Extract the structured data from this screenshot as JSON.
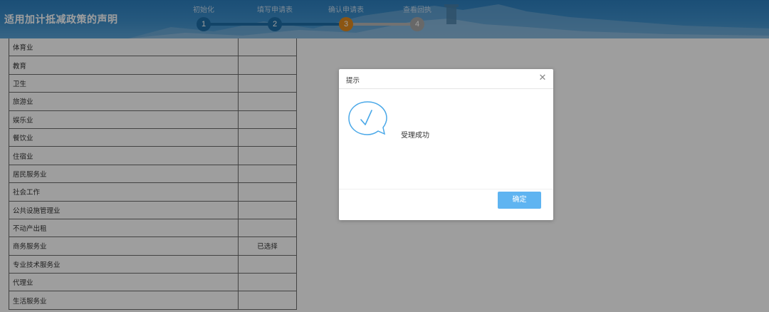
{
  "header": {
    "title": "适用加计抵减政策的声明",
    "steps": [
      {
        "label": "初始化",
        "number": "1",
        "state": "done"
      },
      {
        "label": "填写申请表",
        "number": "2",
        "state": "done"
      },
      {
        "label": "确认申请表",
        "number": "3",
        "state": "current"
      },
      {
        "label": "查看回执",
        "number": "4",
        "state": "pending"
      }
    ]
  },
  "table": {
    "rows": [
      {
        "name": "体育业",
        "status": ""
      },
      {
        "name": "教育",
        "status": ""
      },
      {
        "name": "卫生",
        "status": ""
      },
      {
        "name": "旅游业",
        "status": ""
      },
      {
        "name": "娱乐业",
        "status": ""
      },
      {
        "name": "餐饮业",
        "status": ""
      },
      {
        "name": "住宿业",
        "status": ""
      },
      {
        "name": "居民服务业",
        "status": ""
      },
      {
        "name": "社会工作",
        "status": ""
      },
      {
        "name": "公共设施管理业",
        "status": ""
      },
      {
        "name": "不动产出租",
        "status": ""
      },
      {
        "name": "商务服务业",
        "status": "已选择"
      },
      {
        "name": "专业技术服务业",
        "status": ""
      },
      {
        "name": "代理业",
        "status": ""
      },
      {
        "name": "生活服务业",
        "status": ""
      }
    ]
  },
  "dialog": {
    "title": "提示",
    "close_icon": "close-icon",
    "icon": "success-check-bubble-icon",
    "message": "受理成功",
    "ok_label": "确定"
  },
  "colors": {
    "header_bg": "#3d8fcb",
    "step_done": "#1d6ea8",
    "step_current": "#e08a1e",
    "step_pending": "#a9a9a9",
    "ok_button": "#5fb4f1",
    "icon_stroke": "#4aa8e8"
  }
}
